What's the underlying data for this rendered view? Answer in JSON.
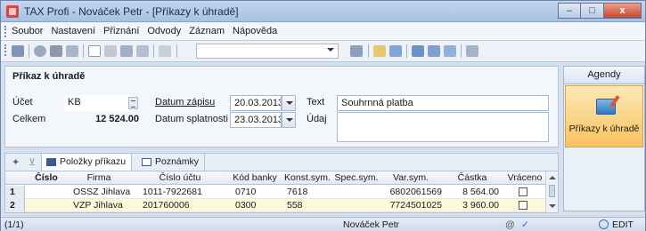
{
  "window": {
    "title": "TAX Profi - Nováček Petr - [Příkazy k úhradě]",
    "controls": {
      "minimize": "–",
      "maximize": "□",
      "close": "x"
    }
  },
  "menu": [
    "Soubor",
    "Nastavení",
    "Přiznání",
    "Odvody",
    "Záznam",
    "Nápověda"
  ],
  "toolbar": {
    "combo_value": "",
    "icons": [
      "open-icon",
      "find-icon",
      "print-icon",
      "preview-icon",
      "new-icon",
      "edit-icon",
      "save-icon",
      "save-as-icon",
      "copy-icon",
      "filter-icon",
      "folder-icon",
      "grid-icon",
      "window-icon",
      "help-icon"
    ]
  },
  "form": {
    "title": "Příkaz k úhradě",
    "ucet_label": "Účet",
    "ucet_value": "KB",
    "celkem_label": "Celkem",
    "celkem_value": "12 524.00",
    "datum_zapisu_label": "Datum zápisu",
    "datum_zapisu_value": "20.03.2013",
    "datum_splatnosti_label": "Datum splatnosti",
    "datum_splatnosti_value": "23.03.2013",
    "text_label": "Text",
    "text_value": "Souhrnná platba",
    "udaj_label": "Údaj",
    "udaj_value": ""
  },
  "agendy": {
    "header": "Agendy",
    "item_label": "Příkazy k úhradě"
  },
  "tabs": [
    {
      "label": "Položky příkazu",
      "active": true
    },
    {
      "label": "Poznámky",
      "active": false
    }
  ],
  "grid": {
    "columns": [
      "Číslo",
      "Firma",
      "Číslo účtu",
      "Kód banky",
      "Konst.sym.",
      "Spec.sym.",
      "Var.sym.",
      "Částka",
      "Vráceno"
    ],
    "rows": [
      {
        "n": "1",
        "cislo": "",
        "firma": "OSSZ Jihlava",
        "cislo_uctu": "1011-7922681",
        "kod_banky": "0710",
        "konst": "7618",
        "spec": "",
        "var": "6802061569",
        "castka": "8 564.00",
        "vraceno": false
      },
      {
        "n": "2",
        "cislo": "",
        "firma": "VZP Jihlava",
        "cislo_uctu": "201760006",
        "kod_banky": "0300",
        "konst": "558",
        "spec": "",
        "var": "7724501025",
        "castka": "3 960.00",
        "vraceno": false
      }
    ]
  },
  "status": {
    "position": "(1/1)",
    "user": "Nováček Petr",
    "mode": "EDIT"
  }
}
